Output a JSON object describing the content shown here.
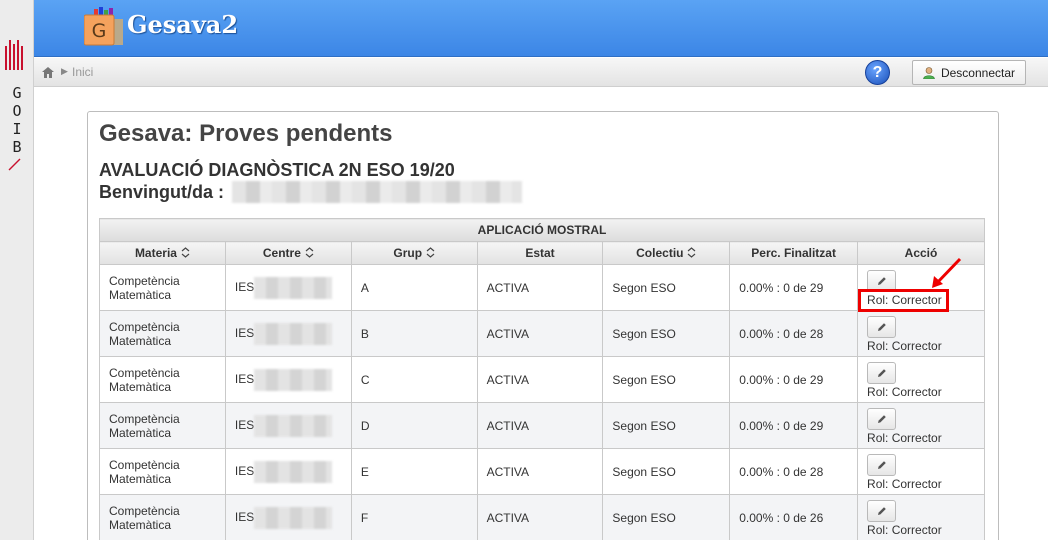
{
  "goib": {
    "letters": [
      "G",
      "O",
      "I",
      "B"
    ]
  },
  "header": {
    "app_title": "Gesava2",
    "logo_letter": "G"
  },
  "breadcrumb": {
    "home": "Inici"
  },
  "toolbar": {
    "help": "?",
    "logout_label": "Desconnectar"
  },
  "page": {
    "title": "Gesava: Proves pendents",
    "subtitle": "AVALUACIÓ DIAGNÒSTICA 2N ESO 19/20",
    "welcome": "Benvingut/da :"
  },
  "table": {
    "caption": "APLICACIÓ MOSTRAL",
    "headers": [
      "Materia",
      "Centre",
      "Grup",
      "Estat",
      "Colectiu",
      "Perc. Finalitzat",
      "Acció"
    ],
    "rows": [
      {
        "materia": "Competència Matemàtica",
        "centre": "IES",
        "grup": "A",
        "estat": "ACTIVA",
        "colectiu": "Segon ESO",
        "perc": "0.00% : 0 de 29",
        "rol": "Rol: Corrector"
      },
      {
        "materia": "Competència Matemàtica",
        "centre": "IES",
        "grup": "B",
        "estat": "ACTIVA",
        "colectiu": "Segon ESO",
        "perc": "0.00% : 0 de 28",
        "rol": "Rol: Corrector"
      },
      {
        "materia": "Competència Matemàtica",
        "centre": "IES",
        "grup": "C",
        "estat": "ACTIVA",
        "colectiu": "Segon ESO",
        "perc": "0.00% : 0 de 29",
        "rol": "Rol: Corrector"
      },
      {
        "materia": "Competència Matemàtica",
        "centre": "IES",
        "grup": "D",
        "estat": "ACTIVA",
        "colectiu": "Segon ESO",
        "perc": "0.00% : 0 de 29",
        "rol": "Rol: Corrector"
      },
      {
        "materia": "Competència Matemàtica",
        "centre": "IES",
        "grup": "E",
        "estat": "ACTIVA",
        "colectiu": "Segon ESO",
        "perc": "0.00% : 0 de 28",
        "rol": "Rol: Corrector"
      },
      {
        "materia": "Competència Matemàtica",
        "centre": "IES",
        "grup": "F",
        "estat": "ACTIVA",
        "colectiu": "Segon ESO",
        "perc": "0.00% : 0 de 26",
        "rol": "Rol: Corrector"
      }
    ]
  },
  "colors": {
    "header_blue": "#3c86e6",
    "highlight_red": "#e00000"
  },
  "icons": [
    "home-icon",
    "help-icon",
    "user-icon",
    "sort-icon",
    "pencil-icon"
  ]
}
